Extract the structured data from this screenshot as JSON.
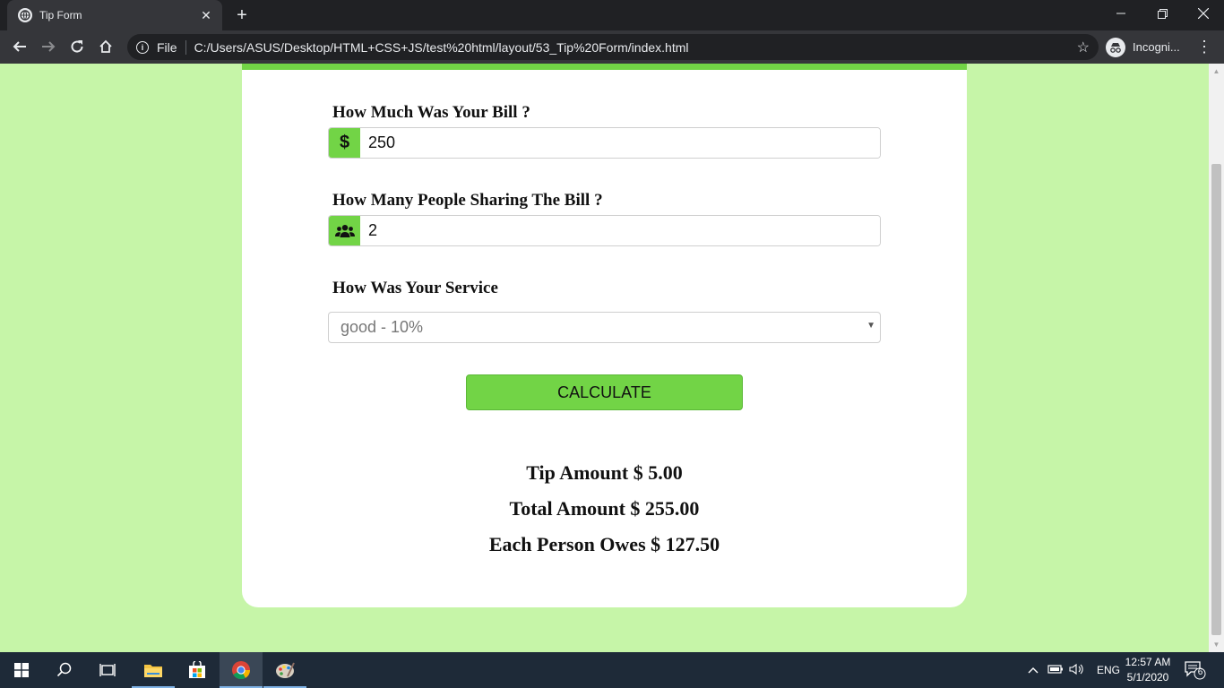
{
  "browser": {
    "tab_title": "Tip Form",
    "omnibox_scheme_label": "File",
    "url": "C:/Users/ASUS/Desktop/HTML+CSS+JS/test%20html/layout/53_Tip%20Form/index.html",
    "profile_label": "Incogni..."
  },
  "form": {
    "bill_label": "How Much Was Your Bill ?",
    "bill_value": "250",
    "people_label": "How Many People Sharing The Bill ?",
    "people_value": "2",
    "service_label": "How Was Your Service",
    "service_selected": "good - 10%",
    "calculate_label": "CALCULATE"
  },
  "results": {
    "tip": "Tip Amount $ 5.00",
    "total": "Total Amount $ 255.00",
    "each": "Each Person Owes $ 127.50"
  },
  "taskbar": {
    "language": "ENG",
    "time": "12:57 AM",
    "date": "5/1/2020",
    "notification_count": "6"
  },
  "colors": {
    "page_background": "#c6f5a8",
    "accent_green": "#72d446"
  }
}
